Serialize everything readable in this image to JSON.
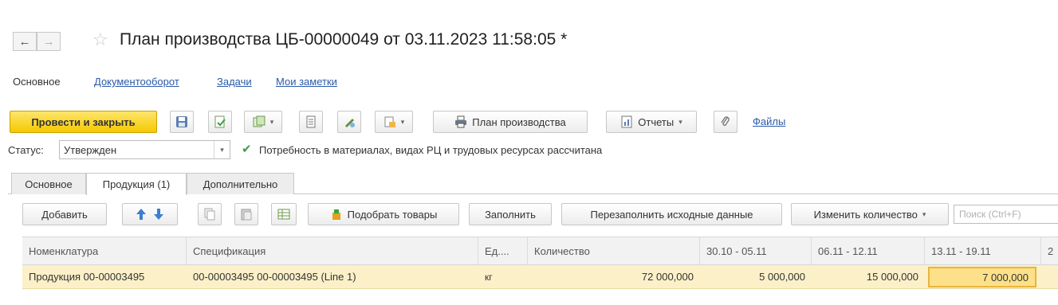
{
  "window": {
    "title": "План производства ЦБ-00000049 от 03.11.2023 11:58:05 *",
    "back_glyph": "←",
    "forward_glyph": "→",
    "star_glyph": "☆"
  },
  "sections": [
    {
      "label": "Основное"
    },
    {
      "label": "Документооборот"
    },
    {
      "label": "Задачи"
    },
    {
      "label": "Мои заметки"
    }
  ],
  "toolbar": {
    "post_close_label": "Провести и закрыть",
    "plan_label": "План производства",
    "reports_label": "Отчеты",
    "files_label": "Файлы",
    "icons": [
      "save-icon",
      "post-icon",
      "create-based-on-icon",
      "journal-icon",
      "edit-icon",
      "attach-doc-icon",
      "print-icon",
      "reports-icon",
      "paperclip-icon"
    ]
  },
  "status": {
    "label": "Статус:",
    "value": "Утвержден",
    "message": "Потребность в материалах, видах РЦ и трудовых ресурсах рассчитана"
  },
  "tabs": [
    {
      "label": "Основное"
    },
    {
      "label": "Продукция (1)"
    },
    {
      "label": "Дополнительно"
    }
  ],
  "table_toolbar": {
    "add_label": "Добавить",
    "pick_goods_label": "Подобрать товары",
    "fill_label": "Заполнить",
    "refill_label": "Перезаполнить исходные данные",
    "change_qty_label": "Изменить количество",
    "search_placeholder": "Поиск (Ctrl+F)"
  },
  "table": {
    "columns": [
      "Номенклатура",
      "Спецификация",
      "Ед....",
      "Количество",
      "30.10 - 05.11",
      "06.11 - 12.11",
      "13.11 - 19.11",
      "2"
    ],
    "rows": [
      [
        "Продукция 00-00003495",
        "00-00003495 00-00003495 (Line 1)",
        "кг",
        "72 000,000",
        "5 000,000",
        "15 000,000",
        "7 000,000",
        ""
      ]
    ]
  },
  "colors": {
    "primary_button": "#f6c800",
    "selected_row": "#fbf0c8",
    "selected_cell": "#fde18a",
    "link": "#2a5aa8",
    "check": "#3aa043"
  }
}
